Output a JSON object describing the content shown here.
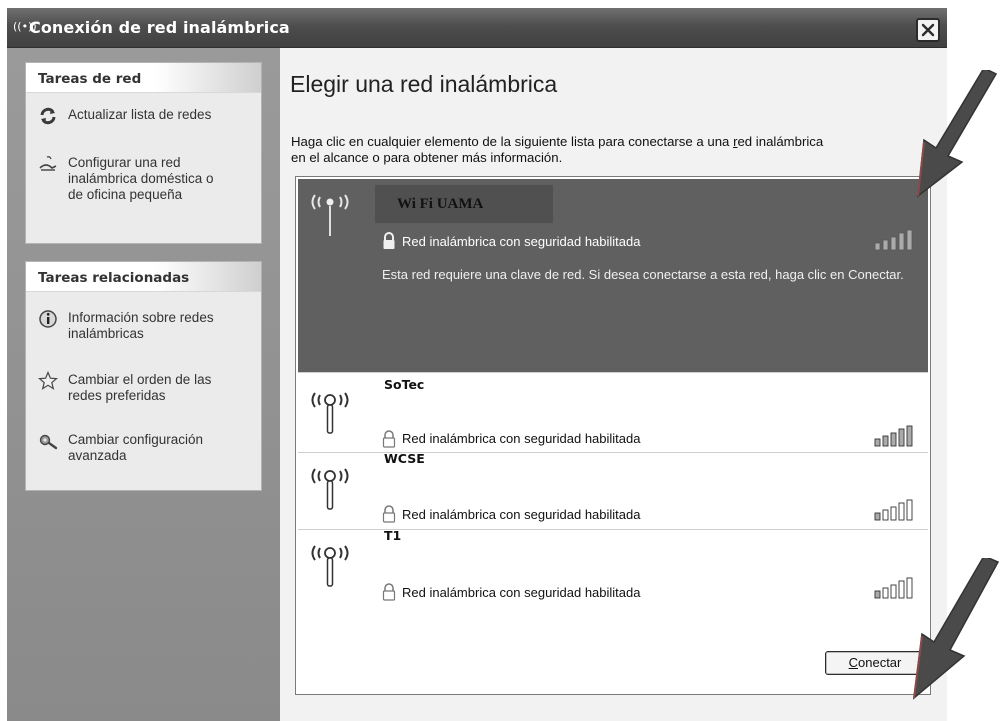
{
  "window": {
    "title": "Conexión de red inalámbrica",
    "title_icon": "wireless-icon"
  },
  "sidebar": {
    "network_tasks": {
      "header": "Tareas de red",
      "items": [
        {
          "label": "Actualizar lista de redes",
          "icon": "refresh-icon"
        },
        {
          "label": "Configurar una red inalámbrica doméstica o de oficina pequeña",
          "icon": "setup-network-icon"
        }
      ]
    },
    "related_tasks": {
      "header": "Tareas relacionadas",
      "items": [
        {
          "label": "Información sobre redes inalámbricas",
          "icon": "info-icon"
        },
        {
          "label": "Cambiar el orden de las redes preferidas",
          "icon": "star-icon"
        },
        {
          "label": "Cambiar configuración avanzada",
          "icon": "settings-icon"
        }
      ]
    }
  },
  "main": {
    "title": "Elegir una red inalámbrica",
    "instructions_line1_pre": "Haga clic en cualquier elemento de la siguiente lista para conectarse a una ",
    "instructions_line1_u": "r",
    "instructions_line1_post": "ed inalámbrica",
    "instructions_line2": "en el alcance o para obtener más información.",
    "networks": [
      {
        "name": "Wi Fi UAMA",
        "security": "Red inalámbrica con seguridad habilitada",
        "description": "Esta red requiere una clave de red. Si desea conectarse a esta red, haga clic en Conectar.",
        "selected": true,
        "signal": 5
      },
      {
        "name": "SoTec",
        "security": "Red inalámbrica con seguridad habilitada",
        "selected": false,
        "signal": 5
      },
      {
        "name": "WCSE",
        "security": "Red inalámbrica con seguridad habilitada",
        "selected": false,
        "signal": 4
      },
      {
        "name": "T1",
        "security": "Red inalámbrica con seguridad habilitada",
        "selected": false,
        "signal": 4
      }
    ],
    "connect_underlined": "C",
    "connect_rest": "onectar"
  },
  "colors": {
    "selected_row": "#606060",
    "sidebar": "#8f8f8f",
    "arrow": "#4a4a4a"
  }
}
